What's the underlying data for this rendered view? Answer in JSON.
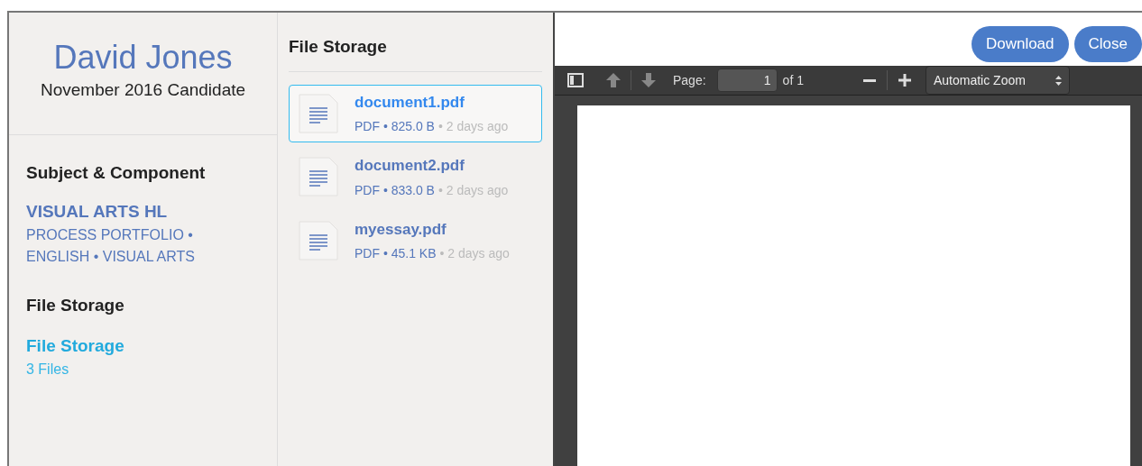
{
  "candidate": {
    "name": "David Jones",
    "session": "November 2016 Candidate"
  },
  "subject": {
    "heading": "Subject & Component",
    "title": "VISUAL ARTS HL",
    "detail": "PROCESS PORTFOLIO • ENGLISH • VISUAL ARTS"
  },
  "storage_nav": {
    "heading": "File Storage",
    "link": "File Storage",
    "count": "3 Files"
  },
  "file_list": {
    "heading": "File Storage",
    "files": [
      {
        "name": "document1.pdf",
        "meta": "PDF • 825.0 B",
        "age": "• 2 days ago",
        "selected": true
      },
      {
        "name": "document2.pdf",
        "meta": "PDF • 833.0 B",
        "age": "• 2 days ago",
        "selected": false
      },
      {
        "name": "myessay.pdf",
        "meta": "PDF • 45.1 KB",
        "age": "• 2 days ago",
        "selected": false
      }
    ]
  },
  "actions": [
    "Download",
    "Close"
  ],
  "viewer": {
    "page_label": "Page:",
    "page": "1",
    "page_count": "of 1",
    "zoom": "Automatic Zoom"
  }
}
